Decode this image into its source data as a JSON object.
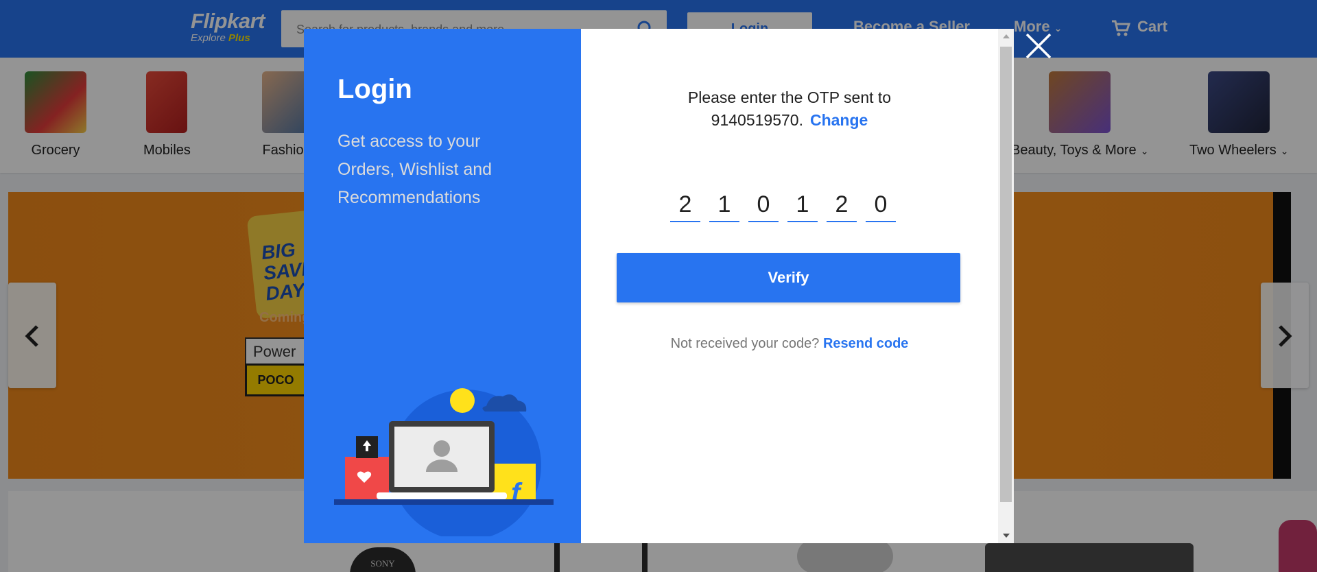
{
  "header": {
    "logo_main": "Flipkart",
    "logo_sub_prefix": "Explore ",
    "logo_sub_plus": "Plus",
    "search_placeholder": "Search for products, brands and more",
    "login_label": "Login",
    "become_seller_label": "Become a Seller",
    "more_label": "More",
    "cart_label": "Cart"
  },
  "categories": [
    {
      "label": "Grocery",
      "has_dropdown": false
    },
    {
      "label": "Mobiles",
      "has_dropdown": false
    },
    {
      "label": "Fashion",
      "has_dropdown": true
    },
    {
      "label": "Beauty, Toys & More",
      "has_dropdown": true
    },
    {
      "label": "Two Wheelers",
      "has_dropdown": true
    }
  ],
  "banner": {
    "bag_text": "BIG SAVING DAYS",
    "coming_text": "Coming",
    "powered_text": "Power",
    "poco_text": "POCO"
  },
  "product_strip": {
    "sony_text": "SONY"
  },
  "login_modal": {
    "title": "Login",
    "description": "Get access to your Orders, Wishlist and Recommendations",
    "otp_prompt_line1": "Please enter the OTP sent to",
    "phone_number": "9140519570.",
    "change_label": "Change",
    "otp_digits": [
      "2",
      "1",
      "0",
      "1",
      "2",
      "0"
    ],
    "verify_label": "Verify",
    "resend_prompt": "Not received your code?",
    "resend_label": "Resend code"
  },
  "colors": {
    "brand_blue": "#2874f0",
    "brand_yellow": "#ffe500",
    "banner_orange": "#f7921e"
  }
}
